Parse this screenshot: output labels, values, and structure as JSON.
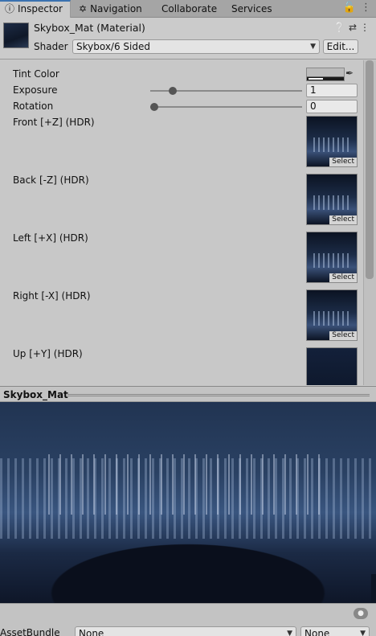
{
  "tabs": [
    {
      "label": "Inspector",
      "icon": "info-icon",
      "active": true
    },
    {
      "label": "Navigation",
      "icon": "navigation-icon",
      "active": false
    },
    {
      "label": "Collaborate",
      "active": false
    },
    {
      "label": "Services",
      "active": false
    }
  ],
  "header": {
    "title": "Skybox_Mat (Material)",
    "shader_label": "Shader",
    "shader_value": "Skybox/6 Sided",
    "edit_label": "Edit..."
  },
  "properties": {
    "tint_label": "Tint Color",
    "exposure_label": "Exposure",
    "exposure_value": "1",
    "rotation_label": "Rotation",
    "rotation_value": "0",
    "front_label": "Front [+Z]   (HDR)",
    "back_label": "Back [-Z]   (HDR)",
    "left_label": "Left [+X]   (HDR)",
    "right_label": "Right [-X]   (HDR)",
    "up_label": "Up [+Y]   (HDR)",
    "select_label": "Select"
  },
  "preview": {
    "title": "Skybox_Mat"
  },
  "footer": {
    "assetbundle_label": "AssetBundle",
    "bundle_value": "None",
    "variant_value": "None"
  },
  "colors": {
    "accent": "#3a72b0",
    "panel": "#c8c8c8"
  }
}
